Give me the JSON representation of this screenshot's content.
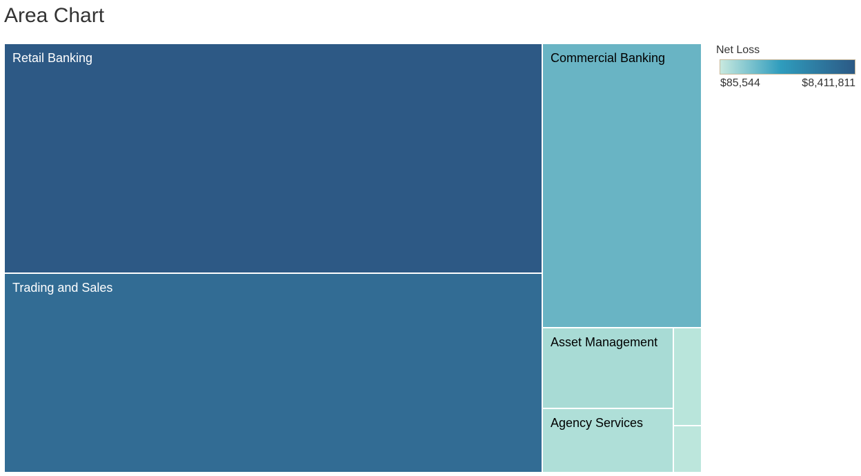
{
  "chart_data": {
    "type": "treemap",
    "title": "Area Chart",
    "color_legend": {
      "title": "Net Loss",
      "min_label": "$85,544",
      "max_label": "$8,411,811",
      "min_color": "#c8e9df",
      "mid_color": "#2f9cbd",
      "max_color": "#2c5985"
    },
    "items": [
      {
        "label": "Retail Banking",
        "relative_area": 259.2,
        "color": "#2d5985",
        "text_color": "#ffffff"
      },
      {
        "label": "Trading and Sales",
        "relative_area": 224.6,
        "color": "#326c94",
        "text_color": "#ffffff"
      },
      {
        "label": "Commercial Banking",
        "relative_area": 94.6,
        "color": "#69b4c4",
        "text_color": "#000000"
      },
      {
        "label": "Asset Management",
        "relative_area": 22.3,
        "color": "#a8dbd5",
        "text_color": "#000000"
      },
      {
        "label": "Agency Services",
        "relative_area": 17.4,
        "color": "#afdfd8",
        "text_color": "#000000"
      },
      {
        "label": "",
        "relative_area": 5.7,
        "color": "#b9e5db",
        "text_color": "#000000"
      },
      {
        "label": "",
        "relative_area": 2.7,
        "color": "#bce6dc",
        "text_color": "#000000"
      }
    ]
  }
}
